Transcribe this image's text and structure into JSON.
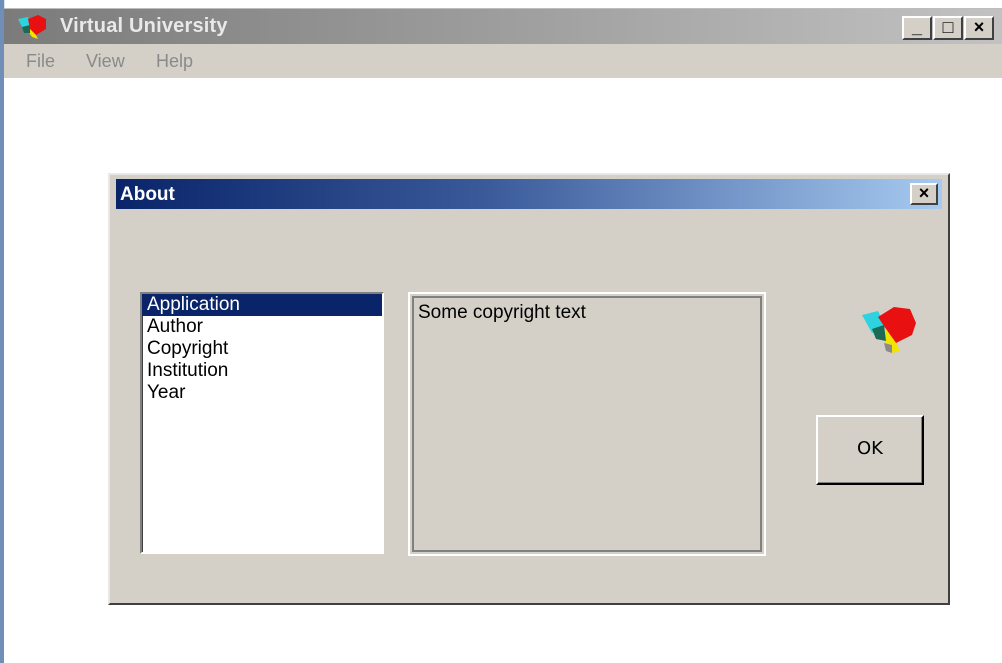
{
  "app": {
    "title": "Virtual University",
    "logo_icon": "virtual-university-logo-icon",
    "caption_buttons": {
      "minimize": "_",
      "maximize": "□",
      "close": "×"
    },
    "menu": [
      "File",
      "View",
      "Help"
    ]
  },
  "dialog": {
    "title": "About",
    "close_label": "×",
    "list_items": [
      {
        "label": "Application",
        "selected": true
      },
      {
        "label": "Author",
        "selected": false
      },
      {
        "label": "Copyright",
        "selected": false
      },
      {
        "label": "Institution",
        "selected": false
      },
      {
        "label": "Year",
        "selected": false
      }
    ],
    "content_text": "Some copyright text",
    "logo_icon": "virtual-university-logo-icon",
    "ok_label": "OK"
  },
  "colors": {
    "dialog_title_start": "#0a246a",
    "dialog_title_end": "#a6caf0",
    "selection": "#0a246a",
    "face": "#d4d0c8"
  }
}
